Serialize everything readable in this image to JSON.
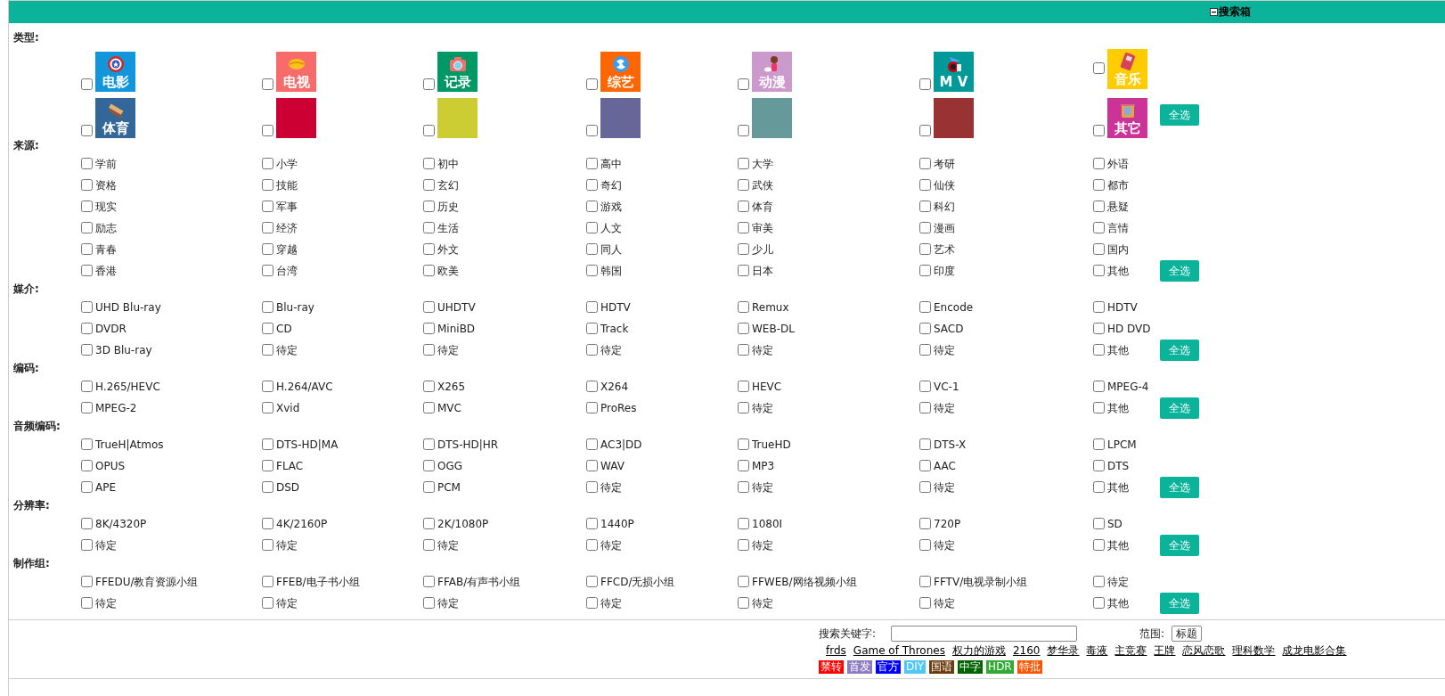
{
  "header": {
    "title": "搜索箱",
    "expanded": true
  },
  "categories": {
    "label": "类型:",
    "select_all": "全选",
    "rows": [
      [
        {
          "label": "电影",
          "color": "#1296db",
          "checked": false
        },
        {
          "label": "电视",
          "color": "#f76b6b",
          "checked": false
        },
        {
          "label": "记录",
          "color": "#009966",
          "checked": false
        },
        {
          "label": "综艺",
          "color": "#ff6600",
          "checked": false
        },
        {
          "label": "动漫",
          "color": "#cc99cc",
          "checked": false
        },
        {
          "label": "M V",
          "color": "#009999",
          "checked": false
        },
        {
          "label": "音乐",
          "color": "#ffcc00",
          "checked": false
        }
      ],
      [
        {
          "label": "体育",
          "color": "#336699",
          "checked": false
        },
        {
          "color": "#cc0033",
          "checked": false
        },
        {
          "color": "#cccc33",
          "checked": false
        },
        {
          "color": "#666699",
          "checked": false
        },
        {
          "color": "#669999",
          "checked": false
        },
        {
          "color": "#993333",
          "checked": false
        },
        {
          "label": "其它",
          "color": "#cc3399",
          "checked": false
        }
      ]
    ]
  },
  "sections": [
    {
      "label": "来源:",
      "select_all": "全选",
      "rows": [
        [
          {
            "label": "学前",
            "checked": false
          },
          {
            "label": "小学",
            "checked": false
          },
          {
            "label": "初中",
            "checked": false
          },
          {
            "label": "高中",
            "checked": false
          },
          {
            "label": "大学",
            "checked": false
          },
          {
            "label": "考研",
            "checked": false
          },
          {
            "label": "外语",
            "checked": false
          }
        ],
        [
          {
            "label": "资格",
            "checked": false
          },
          {
            "label": "技能",
            "checked": false
          },
          {
            "label": "玄幻",
            "checked": false
          },
          {
            "label": "奇幻",
            "checked": false
          },
          {
            "label": "武侠",
            "checked": false
          },
          {
            "label": "仙侠",
            "checked": false
          },
          {
            "label": "都市",
            "checked": false
          }
        ],
        [
          {
            "label": "现实",
            "checked": false
          },
          {
            "label": "军事",
            "checked": false
          },
          {
            "label": "历史",
            "checked": false
          },
          {
            "label": "游戏",
            "checked": false
          },
          {
            "label": "体育",
            "checked": false
          },
          {
            "label": "科幻",
            "checked": false
          },
          {
            "label": "悬疑",
            "checked": false
          }
        ],
        [
          {
            "label": "励志",
            "checked": false
          },
          {
            "label": "经济",
            "checked": false
          },
          {
            "label": "生活",
            "checked": false
          },
          {
            "label": "人文",
            "checked": false
          },
          {
            "label": "审美",
            "checked": false
          },
          {
            "label": "漫画",
            "checked": false
          },
          {
            "label": "言情",
            "checked": false
          }
        ],
        [
          {
            "label": "青春",
            "checked": false
          },
          {
            "label": "穿越",
            "checked": false
          },
          {
            "label": "外文",
            "checked": false
          },
          {
            "label": "同人",
            "checked": false
          },
          {
            "label": "少儿",
            "checked": false
          },
          {
            "label": "艺术",
            "checked": false
          },
          {
            "label": "国内",
            "checked": false
          }
        ],
        [
          {
            "label": "香港",
            "checked": false
          },
          {
            "label": "台湾",
            "checked": false
          },
          {
            "label": "欧美",
            "checked": false
          },
          {
            "label": "韩国",
            "checked": false
          },
          {
            "label": "日本",
            "checked": false
          },
          {
            "label": "印度",
            "checked": false
          },
          {
            "label": "其他",
            "checked": false
          }
        ]
      ]
    },
    {
      "label": "媒介:",
      "select_all": "全选",
      "rows": [
        [
          {
            "label": "UHD Blu-ray",
            "checked": false
          },
          {
            "label": "Blu-ray",
            "checked": false
          },
          {
            "label": "UHDTV",
            "checked": false
          },
          {
            "label": "HDTV",
            "checked": false
          },
          {
            "label": "Remux",
            "checked": false
          },
          {
            "label": "Encode",
            "checked": false
          },
          {
            "label": "HDTV",
            "checked": false
          }
        ],
        [
          {
            "label": "DVDR",
            "checked": false
          },
          {
            "label": "CD",
            "checked": false
          },
          {
            "label": "MiniBD",
            "checked": false
          },
          {
            "label": "Track",
            "checked": false
          },
          {
            "label": "WEB-DL",
            "checked": false
          },
          {
            "label": "SACD",
            "checked": false
          },
          {
            "label": "HD DVD",
            "checked": false
          }
        ],
        [
          {
            "label": "3D Blu-ray",
            "checked": false
          },
          {
            "label": "待定",
            "checked": false
          },
          {
            "label": "待定",
            "checked": false
          },
          {
            "label": "待定",
            "checked": false
          },
          {
            "label": "待定",
            "checked": false
          },
          {
            "label": "待定",
            "checked": false
          },
          {
            "label": "其他",
            "checked": false
          }
        ]
      ]
    },
    {
      "label": "编码:",
      "select_all": "全选",
      "rows": [
        [
          {
            "label": "H.265/HEVC",
            "checked": false
          },
          {
            "label": "H.264/AVC",
            "checked": false
          },
          {
            "label": "X265",
            "checked": false
          },
          {
            "label": "X264",
            "checked": false
          },
          {
            "label": "HEVC",
            "checked": false
          },
          {
            "label": "VC-1",
            "checked": false
          },
          {
            "label": "MPEG-4",
            "checked": false
          }
        ],
        [
          {
            "label": "MPEG-2",
            "checked": false
          },
          {
            "label": "Xvid",
            "checked": false
          },
          {
            "label": "MVC",
            "checked": false
          },
          {
            "label": "ProRes",
            "checked": false
          },
          {
            "label": "待定",
            "checked": false
          },
          {
            "label": "待定",
            "checked": false
          },
          {
            "label": "其他",
            "checked": false
          }
        ]
      ]
    },
    {
      "label": "音频编码:",
      "select_all": "全选",
      "rows": [
        [
          {
            "label": "TrueH|Atmos",
            "checked": false
          },
          {
            "label": "DTS-HD|MA",
            "checked": false
          },
          {
            "label": "DTS-HD|HR",
            "checked": false
          },
          {
            "label": "AC3|DD",
            "checked": false
          },
          {
            "label": "TrueHD",
            "checked": false
          },
          {
            "label": "DTS-X",
            "checked": false
          },
          {
            "label": "LPCM",
            "checked": false
          }
        ],
        [
          {
            "label": "OPUS",
            "checked": false
          },
          {
            "label": "FLAC",
            "checked": false
          },
          {
            "label": "OGG",
            "checked": false
          },
          {
            "label": "WAV",
            "checked": false
          },
          {
            "label": "MP3",
            "checked": false
          },
          {
            "label": "AAC",
            "checked": false
          },
          {
            "label": "DTS",
            "checked": false
          }
        ],
        [
          {
            "label": "APE",
            "checked": false
          },
          {
            "label": "DSD",
            "checked": false
          },
          {
            "label": "PCM",
            "checked": false
          },
          {
            "label": "待定",
            "checked": false
          },
          {
            "label": "待定",
            "checked": false
          },
          {
            "label": "待定",
            "checked": false
          },
          {
            "label": "其他",
            "checked": false
          }
        ]
      ]
    },
    {
      "label": "分辨率:",
      "select_all": "全选",
      "rows": [
        [
          {
            "label": "8K/4320P",
            "checked": false
          },
          {
            "label": "4K/2160P",
            "checked": false
          },
          {
            "label": "2K/1080P",
            "checked": false
          },
          {
            "label": "1440P",
            "checked": false
          },
          {
            "label": "1080I",
            "checked": false
          },
          {
            "label": "720P",
            "checked": false
          },
          {
            "label": "SD",
            "checked": false
          }
        ],
        [
          {
            "label": "待定",
            "checked": false
          },
          {
            "label": "待定",
            "checked": false
          },
          {
            "label": "待定",
            "checked": false
          },
          {
            "label": "待定",
            "checked": false
          },
          {
            "label": "待定",
            "checked": false
          },
          {
            "label": "待定",
            "checked": false
          },
          {
            "label": "其他",
            "checked": false
          }
        ]
      ]
    },
    {
      "label": "制作组:",
      "select_all": "全选",
      "rows": [
        [
          {
            "label": "FFEDU/教育资源小组",
            "checked": false
          },
          {
            "label": "FFEB/电子书小组",
            "checked": false
          },
          {
            "label": "FFAB/有声书小组",
            "checked": false
          },
          {
            "label": "FFCD/无损小组",
            "checked": false
          },
          {
            "label": "FFWEB/网络视频小组",
            "checked": false
          },
          {
            "label": "FFTV/电视录制小组",
            "checked": false
          },
          {
            "label": "待定",
            "checked": false
          }
        ],
        [
          {
            "label": "待定",
            "checked": false
          },
          {
            "label": "待定",
            "checked": false
          },
          {
            "label": "待定",
            "checked": false
          },
          {
            "label": "待定",
            "checked": false
          },
          {
            "label": "待定",
            "checked": false
          },
          {
            "label": "待定",
            "checked": false
          },
          {
            "label": "其他",
            "checked": false
          }
        ]
      ]
    }
  ],
  "search": {
    "label": "搜索关键字:"
  },
  "scope": {
    "label": "范围:",
    "value": "标题"
  },
  "hot_links": [
    "frds",
    "Game of Thrones",
    "权力的游戏",
    "2160",
    "梦华录",
    "毒液",
    "主竞赛",
    "王牌",
    "恋风恋歌",
    "理科数学",
    "成龙电影合集"
  ],
  "tags": [
    {
      "label": "禁转",
      "color": "#ff0000"
    },
    {
      "label": "首发",
      "color": "#8e7cc3"
    },
    {
      "label": "官方",
      "color": "#0000ff"
    },
    {
      "label": "DIY",
      "color": "#4fc8f5"
    },
    {
      "label": "国语",
      "color": "#6b3a0a"
    },
    {
      "label": "中字",
      "color": "#006400"
    },
    {
      "label": "HDR",
      "color": "#33aa33"
    },
    {
      "label": "特批",
      "color": "#ff5500"
    }
  ]
}
